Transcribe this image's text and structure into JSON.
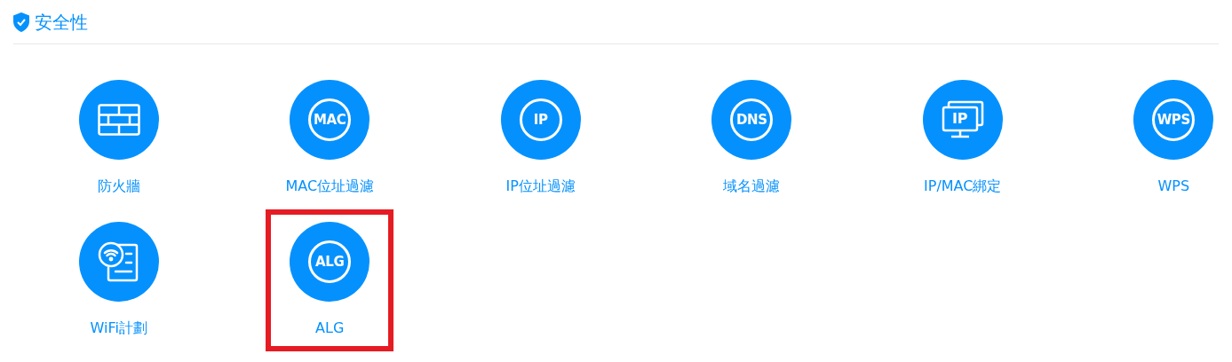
{
  "section": {
    "title": "安全性"
  },
  "items": [
    {
      "label": "防火牆",
      "icon": {
        "kind": "wall"
      },
      "highlighted": false
    },
    {
      "label": "MAC位址過濾",
      "icon": {
        "kind": "badge",
        "text": "MAC"
      },
      "highlighted": false
    },
    {
      "label": "IP位址過濾",
      "icon": {
        "kind": "badge",
        "text": "IP"
      },
      "highlighted": false
    },
    {
      "label": "域名過濾",
      "icon": {
        "kind": "badge",
        "text": "DNS"
      },
      "highlighted": false
    },
    {
      "label": "IP/MAC綁定",
      "icon": {
        "kind": "monitor",
        "text": "IP"
      },
      "highlighted": false
    },
    {
      "label": "WPS",
      "icon": {
        "kind": "badge",
        "text": "WPS"
      },
      "highlighted": false
    },
    {
      "label": "WiFi計劃",
      "icon": {
        "kind": "wifi-schedule"
      },
      "highlighted": false
    },
    {
      "label": "ALG",
      "icon": {
        "kind": "badge",
        "text": "ALG"
      },
      "highlighted": true
    }
  ]
}
